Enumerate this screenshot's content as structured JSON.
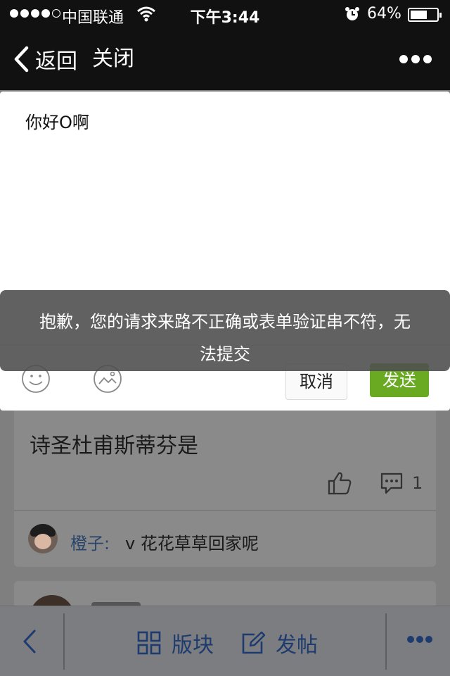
{
  "status_bar": {
    "carrier": "中国联通",
    "time": "下午3:44",
    "battery": "64%",
    "battery_level": 0.64
  },
  "nav": {
    "back_label": "返回",
    "close_label": "关闭"
  },
  "composer": {
    "text": "你好O啊",
    "cancel_label": "取消",
    "send_label": "发送"
  },
  "toast": {
    "message": "抱歉，您的请求来路不正确或表单验证串不符，无法提交"
  },
  "post": {
    "text": "诗圣杜甫斯蒂芬是",
    "comment_count": "1",
    "reply_user": "橙子:",
    "reply_text": "v 花花草草回家呢"
  },
  "bottom_bar": {
    "board_label": "版块",
    "post_label": "发帖"
  },
  "colors": {
    "send_button": "#6aaa22",
    "link_blue": "#29446a",
    "topbar": "#111111"
  }
}
